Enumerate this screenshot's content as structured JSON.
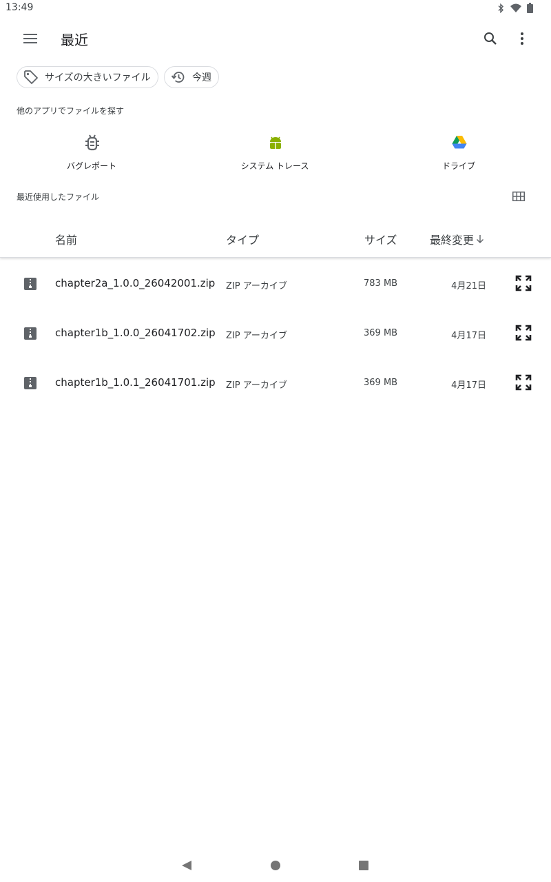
{
  "status_bar": {
    "time": "13:49"
  },
  "toolbar": {
    "title": "最近"
  },
  "chips": {
    "large_files": "サイズの大きいファイル",
    "this_week": "今週"
  },
  "other_apps": {
    "label": "他のアプリでファイルを探す",
    "apps": [
      {
        "label": "バグレポート",
        "icon": "bug-icon"
      },
      {
        "label": "システム トレース",
        "icon": "android-icon"
      },
      {
        "label": "ドライブ",
        "icon": "drive-icon"
      }
    ]
  },
  "recent": {
    "label": "最近使用したファイル"
  },
  "table": {
    "headers": {
      "name": "名前",
      "type": "タイプ",
      "size": "サイズ",
      "modified": "最終変更"
    },
    "rows": [
      {
        "name": "chapter2a_1.0.0_26042001.zip",
        "type": "ZIP アーカイブ",
        "size": "783 MB",
        "date": "4月21日"
      },
      {
        "name": "chapter1b_1.0.0_26041702.zip",
        "type": "ZIP アーカイブ",
        "size": "369 MB",
        "date": "4月17日"
      },
      {
        "name": "chapter1b_1.0.1_26041701.zip",
        "type": "ZIP アーカイブ",
        "size": "369 MB",
        "date": "4月17日"
      }
    ]
  },
  "colors": {
    "android_green": "#8ab000",
    "icon_gray": "#5f6368"
  }
}
